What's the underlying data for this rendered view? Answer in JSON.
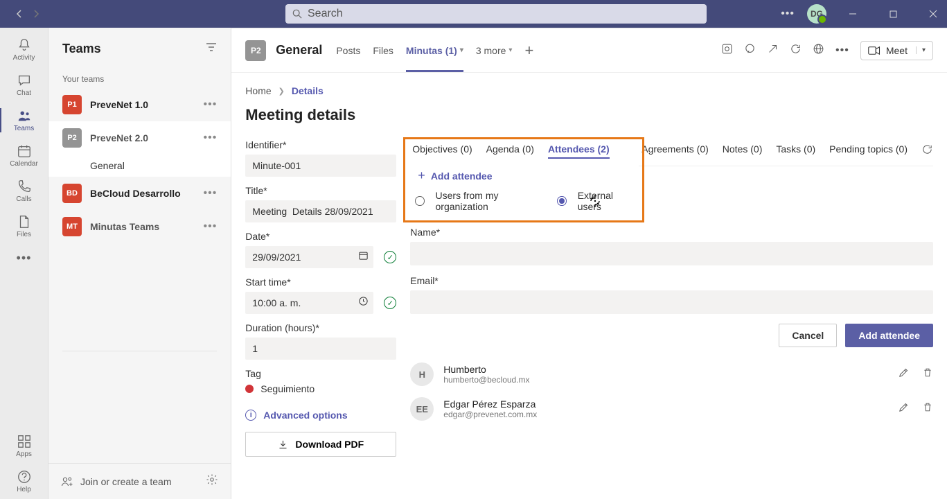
{
  "titlebar": {
    "search_placeholder": "Search",
    "avatar_initials": "DG"
  },
  "rail": {
    "activity": "Activity",
    "chat": "Chat",
    "teams": "Teams",
    "calendar": "Calendar",
    "calls": "Calls",
    "files": "Files",
    "apps": "Apps",
    "help": "Help"
  },
  "teams_panel": {
    "title": "Teams",
    "subtitle": "Your teams",
    "teams": [
      {
        "initials": "P1",
        "name": "PreveNet 1.0",
        "color": "#d64530"
      },
      {
        "initials": "P2",
        "name": "PreveNet 2.0",
        "color": "#949494"
      },
      {
        "initials": "BD",
        "name": "BeCloud Desarrollo",
        "color": "#d64530"
      },
      {
        "initials": "MT",
        "name": "Minutas Teams",
        "color": "#d64530"
      }
    ],
    "channel_general": "General",
    "join": "Join or create a team"
  },
  "channel_header": {
    "icon": "P2",
    "name": "General",
    "tabs": {
      "posts": "Posts",
      "files": "Files",
      "minutas": "Minutas (1)",
      "more": "3 more"
    },
    "meet": "Meet"
  },
  "breadcrumb": {
    "home": "Home",
    "details": "Details"
  },
  "page": {
    "title": "Meeting details",
    "identifier_label": "Identifier*",
    "identifier_value": "Minute-001",
    "title_label": "Title*",
    "title_value": "Meeting  Details 28/09/2021",
    "date_label": "Date*",
    "date_value": "29/09/2021",
    "start_label": "Start time*",
    "start_value": "10:00 a. m.",
    "duration_label": "Duration (hours)*",
    "duration_value": "1",
    "tag_label": "Tag",
    "tag_value": "Seguimiento",
    "advanced": "Advanced options",
    "download": "Download PDF"
  },
  "detail_tabs": {
    "objectives": "Objectives (0)",
    "agenda": "Agenda (0)",
    "attendees": "Attendees (2)",
    "agreements": "Agreements (0)",
    "notes": "Notes (0)",
    "tasks": "Tasks (0)",
    "pending": "Pending topics (0)"
  },
  "attendees_form": {
    "add_link": "Add attendee",
    "radio_org": "Users from my organization",
    "radio_ext": "External users",
    "name_label": "Name*",
    "email_label": "Email*",
    "cancel": "Cancel",
    "add": "Add attendee"
  },
  "attendees": [
    {
      "initials": "H",
      "name": "Humberto",
      "email": "humberto@becloud.mx"
    },
    {
      "initials": "EE",
      "name": "Edgar Pérez Esparza",
      "email": "edgar@prevenet.com.mx"
    }
  ]
}
